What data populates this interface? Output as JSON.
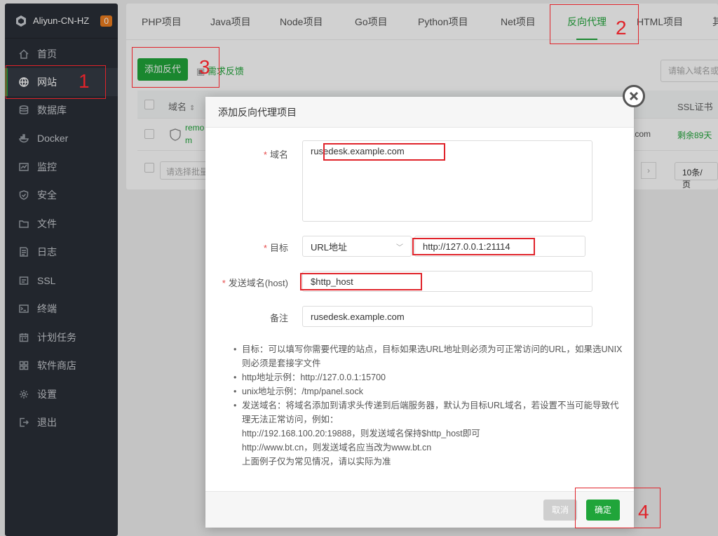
{
  "sidebar": {
    "server_name": "Aliyun-CN-HZ",
    "badge": "0",
    "items": [
      {
        "label": "首页",
        "icon": "home-icon"
      },
      {
        "label": "网站",
        "icon": "globe-icon",
        "active": true
      },
      {
        "label": "数据库",
        "icon": "database-icon"
      },
      {
        "label": "Docker",
        "icon": "docker-icon"
      },
      {
        "label": "监控",
        "icon": "monitor-icon"
      },
      {
        "label": "安全",
        "icon": "shield-icon"
      },
      {
        "label": "文件",
        "icon": "folder-icon"
      },
      {
        "label": "日志",
        "icon": "log-icon"
      },
      {
        "label": "SSL",
        "icon": "ssl-icon"
      },
      {
        "label": "终端",
        "icon": "terminal-icon"
      },
      {
        "label": "计划任务",
        "icon": "calendar-icon"
      },
      {
        "label": "软件商店",
        "icon": "grid-icon"
      },
      {
        "label": "设置",
        "icon": "gear-icon"
      },
      {
        "label": "退出",
        "icon": "logout-icon"
      }
    ]
  },
  "tabs": [
    {
      "label": "PHP项目"
    },
    {
      "label": "Java项目"
    },
    {
      "label": "Node项目"
    },
    {
      "label": "Go项目"
    },
    {
      "label": "Python项目"
    },
    {
      "label": "Net项目"
    },
    {
      "label": "反向代理",
      "active": true
    },
    {
      "label": "HTML项目"
    },
    {
      "label": "其"
    }
  ],
  "toolbar": {
    "add_label": "添加反代",
    "feedback_label": "需求反馈",
    "search_placeholder": "请输入域名或"
  },
  "table": {
    "col_domain": "域名",
    "col_ssl": "SSL证书",
    "row": {
      "domain_short": "remo",
      "domain_tail": "m",
      "target_tail": ".com",
      "ssl": "剩余89天"
    },
    "batch_placeholder": "请选择批量",
    "page_size": "10条/页"
  },
  "modal": {
    "title": "添加反向代理项目",
    "domain_label": "域名",
    "domain_value": "rusedesk.example.com",
    "target_label": "目标",
    "target_type": "URL地址",
    "target_value": "http://127.0.0.1:21114",
    "host_label": "发送域名(host)",
    "host_value": "$http_host",
    "remark_label": "备注",
    "remark_value": "rusedesk.example.com",
    "tips": [
      "目标：可以填写你需要代理的站点，目标如果选URL地址则必须为可正常访问的URL，如果选UNIX则必须是套接字文件",
      "http地址示例：http://127.0.0.1:15700",
      "unix地址示例：/tmp/panel.sock",
      "发送域名：将域名添加到请求头传递到后端服务器，默认为目标URL域名，若设置不当可能导致代理无法正常访问，例如："
    ],
    "tip_sub": [
      "http://192.168.100.20:19888，则发送域名保持$http_host即可",
      "http://www.bt.cn，则发送域名应当改为www.bt.cn",
      "上面例子仅为常见情况，请以实际为准"
    ],
    "cancel_label": "取消",
    "ok_label": "确定"
  },
  "annotations": [
    "1",
    "2",
    "3",
    "4"
  ],
  "colors": {
    "accent": "#20a53a",
    "sidebar": "#2a2f38",
    "annotation": "#e0232a"
  }
}
